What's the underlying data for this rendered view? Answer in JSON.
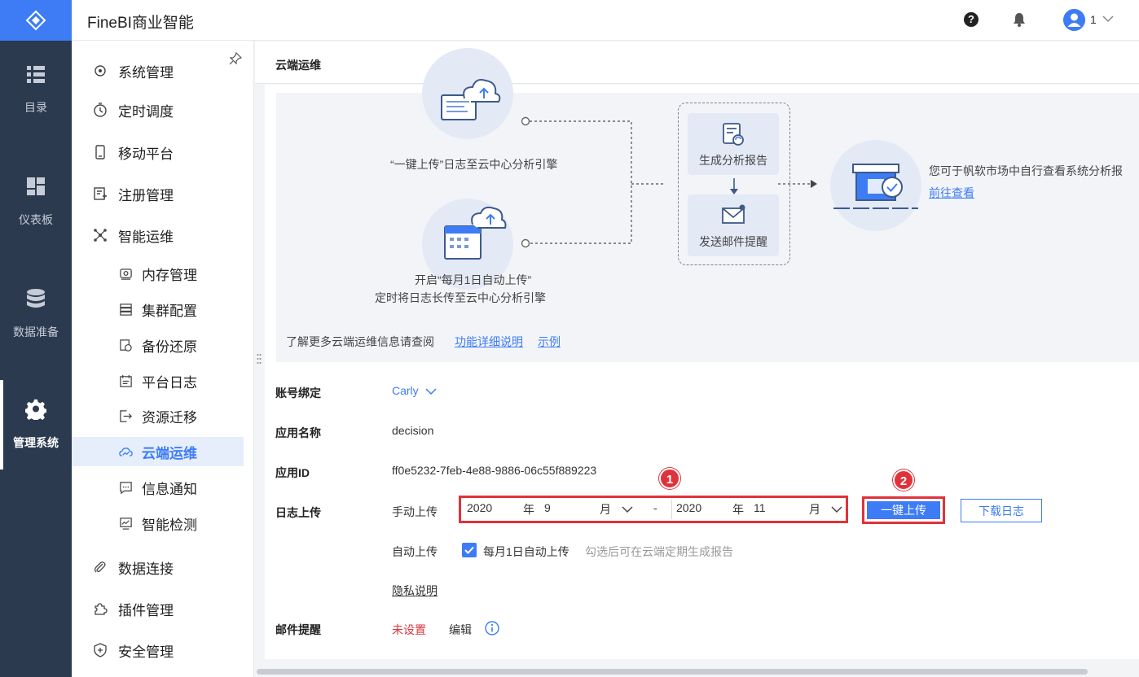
{
  "app": {
    "title": "FineBI商业智能"
  },
  "header": {
    "user_name": "1",
    "help_glyph": "?"
  },
  "rail": {
    "items": [
      {
        "label": "目录",
        "icon": "list-icon"
      },
      {
        "label": "仪表板",
        "icon": "dashboard-icon"
      },
      {
        "label": "数据准备",
        "icon": "database-icon"
      },
      {
        "label": "管理系统",
        "icon": "gear-icon",
        "active": true
      }
    ]
  },
  "submenu": {
    "items": [
      {
        "label": "系统管理",
        "icon": "system-icon"
      },
      {
        "label": "定时调度",
        "icon": "timer-icon"
      },
      {
        "label": "移动平台",
        "icon": "mobile-icon"
      },
      {
        "label": "注册管理",
        "icon": "register-icon"
      },
      {
        "label": "智能运维",
        "icon": "network-icon"
      },
      {
        "label": "内存管理",
        "icon": "memory-icon"
      },
      {
        "label": "集群配置",
        "icon": "cluster-icon"
      },
      {
        "label": "备份还原",
        "icon": "backup-icon"
      },
      {
        "label": "平台日志",
        "icon": "log-icon"
      },
      {
        "label": "资源迁移",
        "icon": "migrate-icon"
      },
      {
        "label": "云端运维",
        "icon": "cloud-ops-icon",
        "active": true
      },
      {
        "label": "信息通知",
        "icon": "message-icon"
      },
      {
        "label": "智能检测",
        "icon": "monitor-icon"
      },
      {
        "label": "数据连接",
        "icon": "link-icon"
      },
      {
        "label": "插件管理",
        "icon": "plugin-icon"
      },
      {
        "label": "安全管理",
        "icon": "shield-icon"
      }
    ]
  },
  "page": {
    "title": "云端运维"
  },
  "diagram": {
    "upload_once": "“一键上传”日志至云中心分析引擎",
    "monthly_line1": "开启“每月1日自动上传”",
    "monthly_line2": "定时将日志长传至云中心分析引擎",
    "gen_report": "生成分析报告",
    "send_email": "发送邮件提醒",
    "market_text": "您可于帆软市场中自行查看系统分析报",
    "market_link": "前往查看",
    "more_info": "了解更多云端运维信息请查阅",
    "link_detail": "功能详细说明",
    "link_example": "示例"
  },
  "form": {
    "account_label": "账号绑定",
    "account_value": "Carly",
    "app_name_label": "应用名称",
    "app_name_value": "decision",
    "app_id_label": "应用ID",
    "app_id_value": "ff0e5232-7feb-4e88-9886-06c55f889223",
    "log_upload_label": "日志上传",
    "manual_upload_label": "手动上传",
    "start_year": "2020",
    "year_unit": "年",
    "start_month": "9",
    "month_unit": "月",
    "range_sep": "-",
    "end_year": "2020",
    "end_month": "11",
    "upload_button": "一键上传",
    "download_button": "下载日志",
    "auto_upload_label": "自动上传",
    "auto_upload_option": "每月1日自动上传",
    "auto_upload_checked": true,
    "auto_upload_hint": "勾选后可在云端定期生成报告",
    "privacy_link": "隐私说明",
    "email_label": "邮件提醒",
    "email_status": "未设置",
    "email_edit": "编辑"
  },
  "annotations": {
    "badge_1": "1",
    "badge_2": "2"
  },
  "colors": {
    "accent": "#3d7cf5",
    "rail_bg": "#2c3a4f",
    "highlight_red": "#e0323a",
    "unset_red": "#d9363e"
  }
}
